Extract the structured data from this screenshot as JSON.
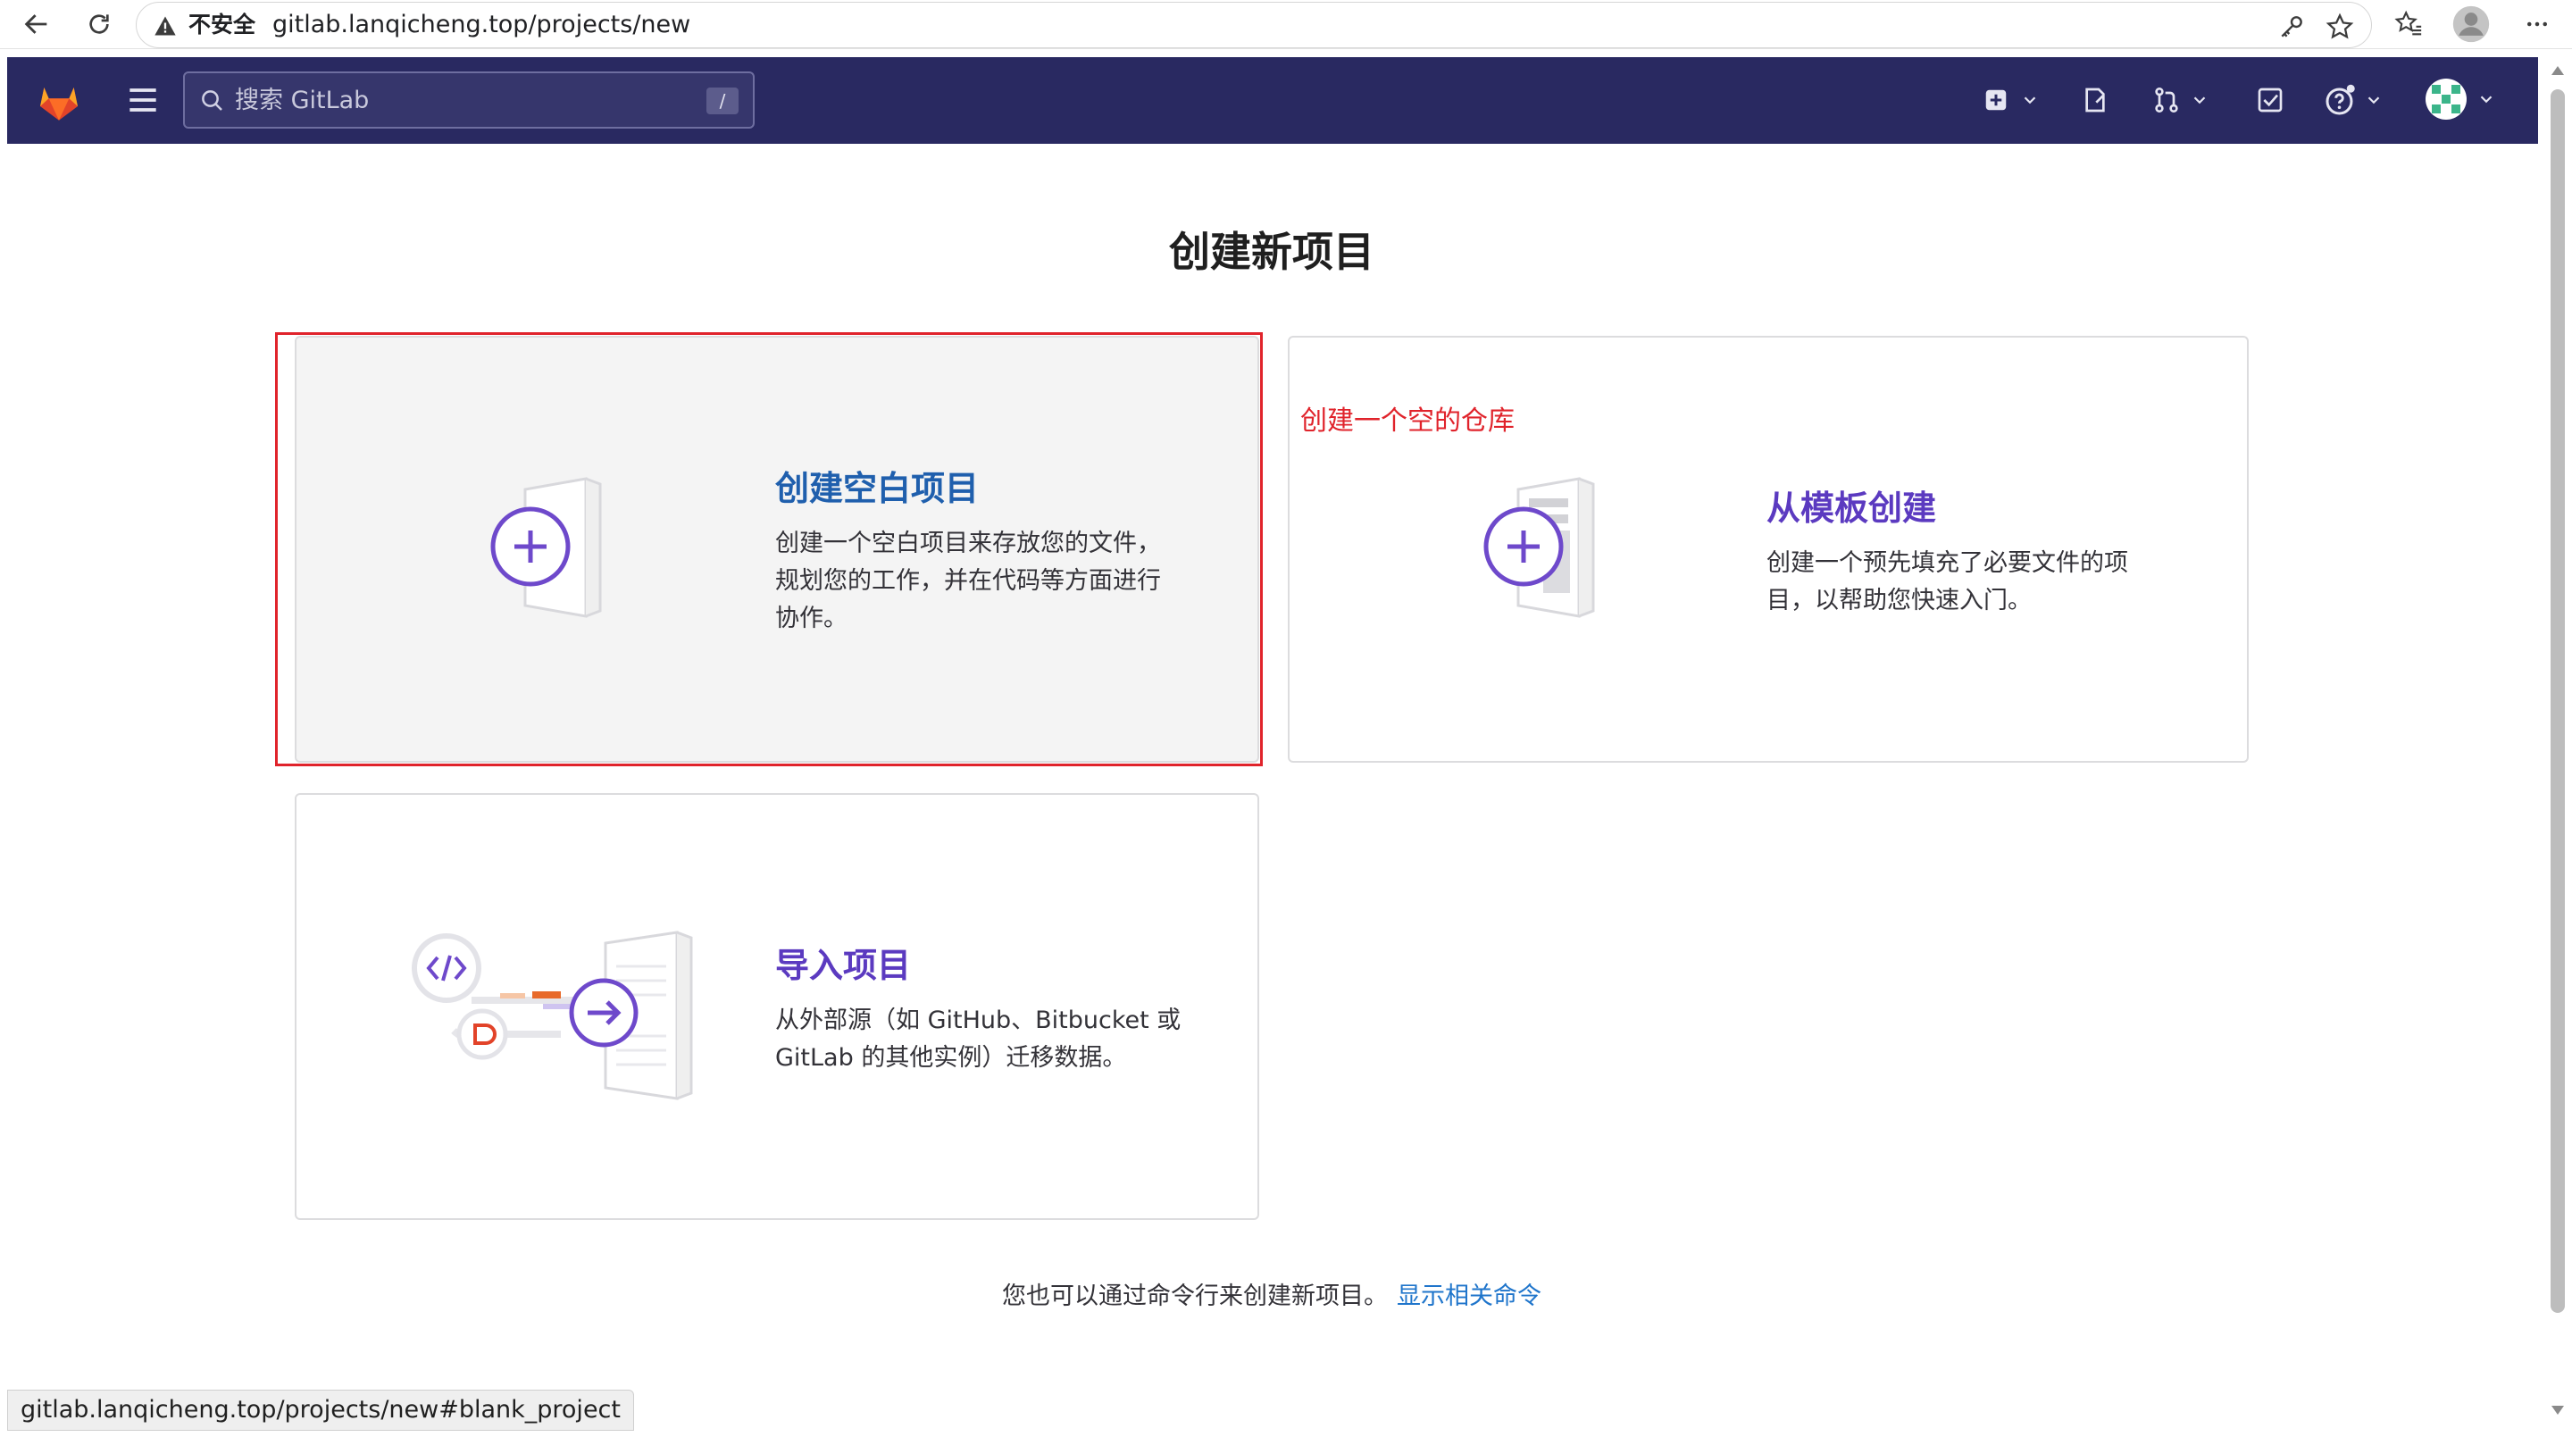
{
  "browser": {
    "security_label": "不安全",
    "url": "gitlab.lanqicheng.top/projects/new",
    "status_url": "gitlab.lanqicheng.top/projects/new#blank_project",
    "icons": [
      "back-icon",
      "reload-icon",
      "warning-icon",
      "key-icon",
      "star-icon",
      "favorites-icon",
      "profile-icon",
      "more-icon"
    ]
  },
  "header": {
    "search_placeholder": "搜索 GitLab",
    "search_shortcut": "/",
    "icons": [
      "gitlab-logo-icon",
      "hamburger-icon",
      "search-icon",
      "new-icon",
      "issues-icon",
      "merge-requests-icon",
      "todos-icon",
      "help-icon",
      "avatar-icon"
    ],
    "colors": {
      "background": "#292961",
      "logo": "#e24329"
    }
  },
  "page": {
    "title": "创建新项目",
    "cards": {
      "blank": {
        "title": "创建空白项目",
        "desc_lines": [
          "创建一个空白项目来存放您的文件，",
          "规划您的工作，并在代码等方面进行",
          "协作。"
        ],
        "title_color": "#1f5fad"
      },
      "template": {
        "title": "从模板创建",
        "desc_lines": [
          "创建一个预先填充了必要文件的项",
          "目，以帮助您快速入门。"
        ],
        "title_color": "#5b3ac0"
      },
      "import": {
        "title": "导入项目",
        "desc_lines": [
          "从外部源（如 GitHub、Bitbucket 或",
          "GitLab 的其他实例）迁移数据。"
        ],
        "title_color": "#5b3ac0"
      }
    },
    "annotation": "创建一个空的仓库",
    "footer_text": "您也可以通过命令行来创建新项目。",
    "footer_link": "显示相关命令",
    "colors": {
      "accent": "#6e49cb",
      "link": "#1f75cb",
      "annotation_red": "#e0232b"
    }
  }
}
